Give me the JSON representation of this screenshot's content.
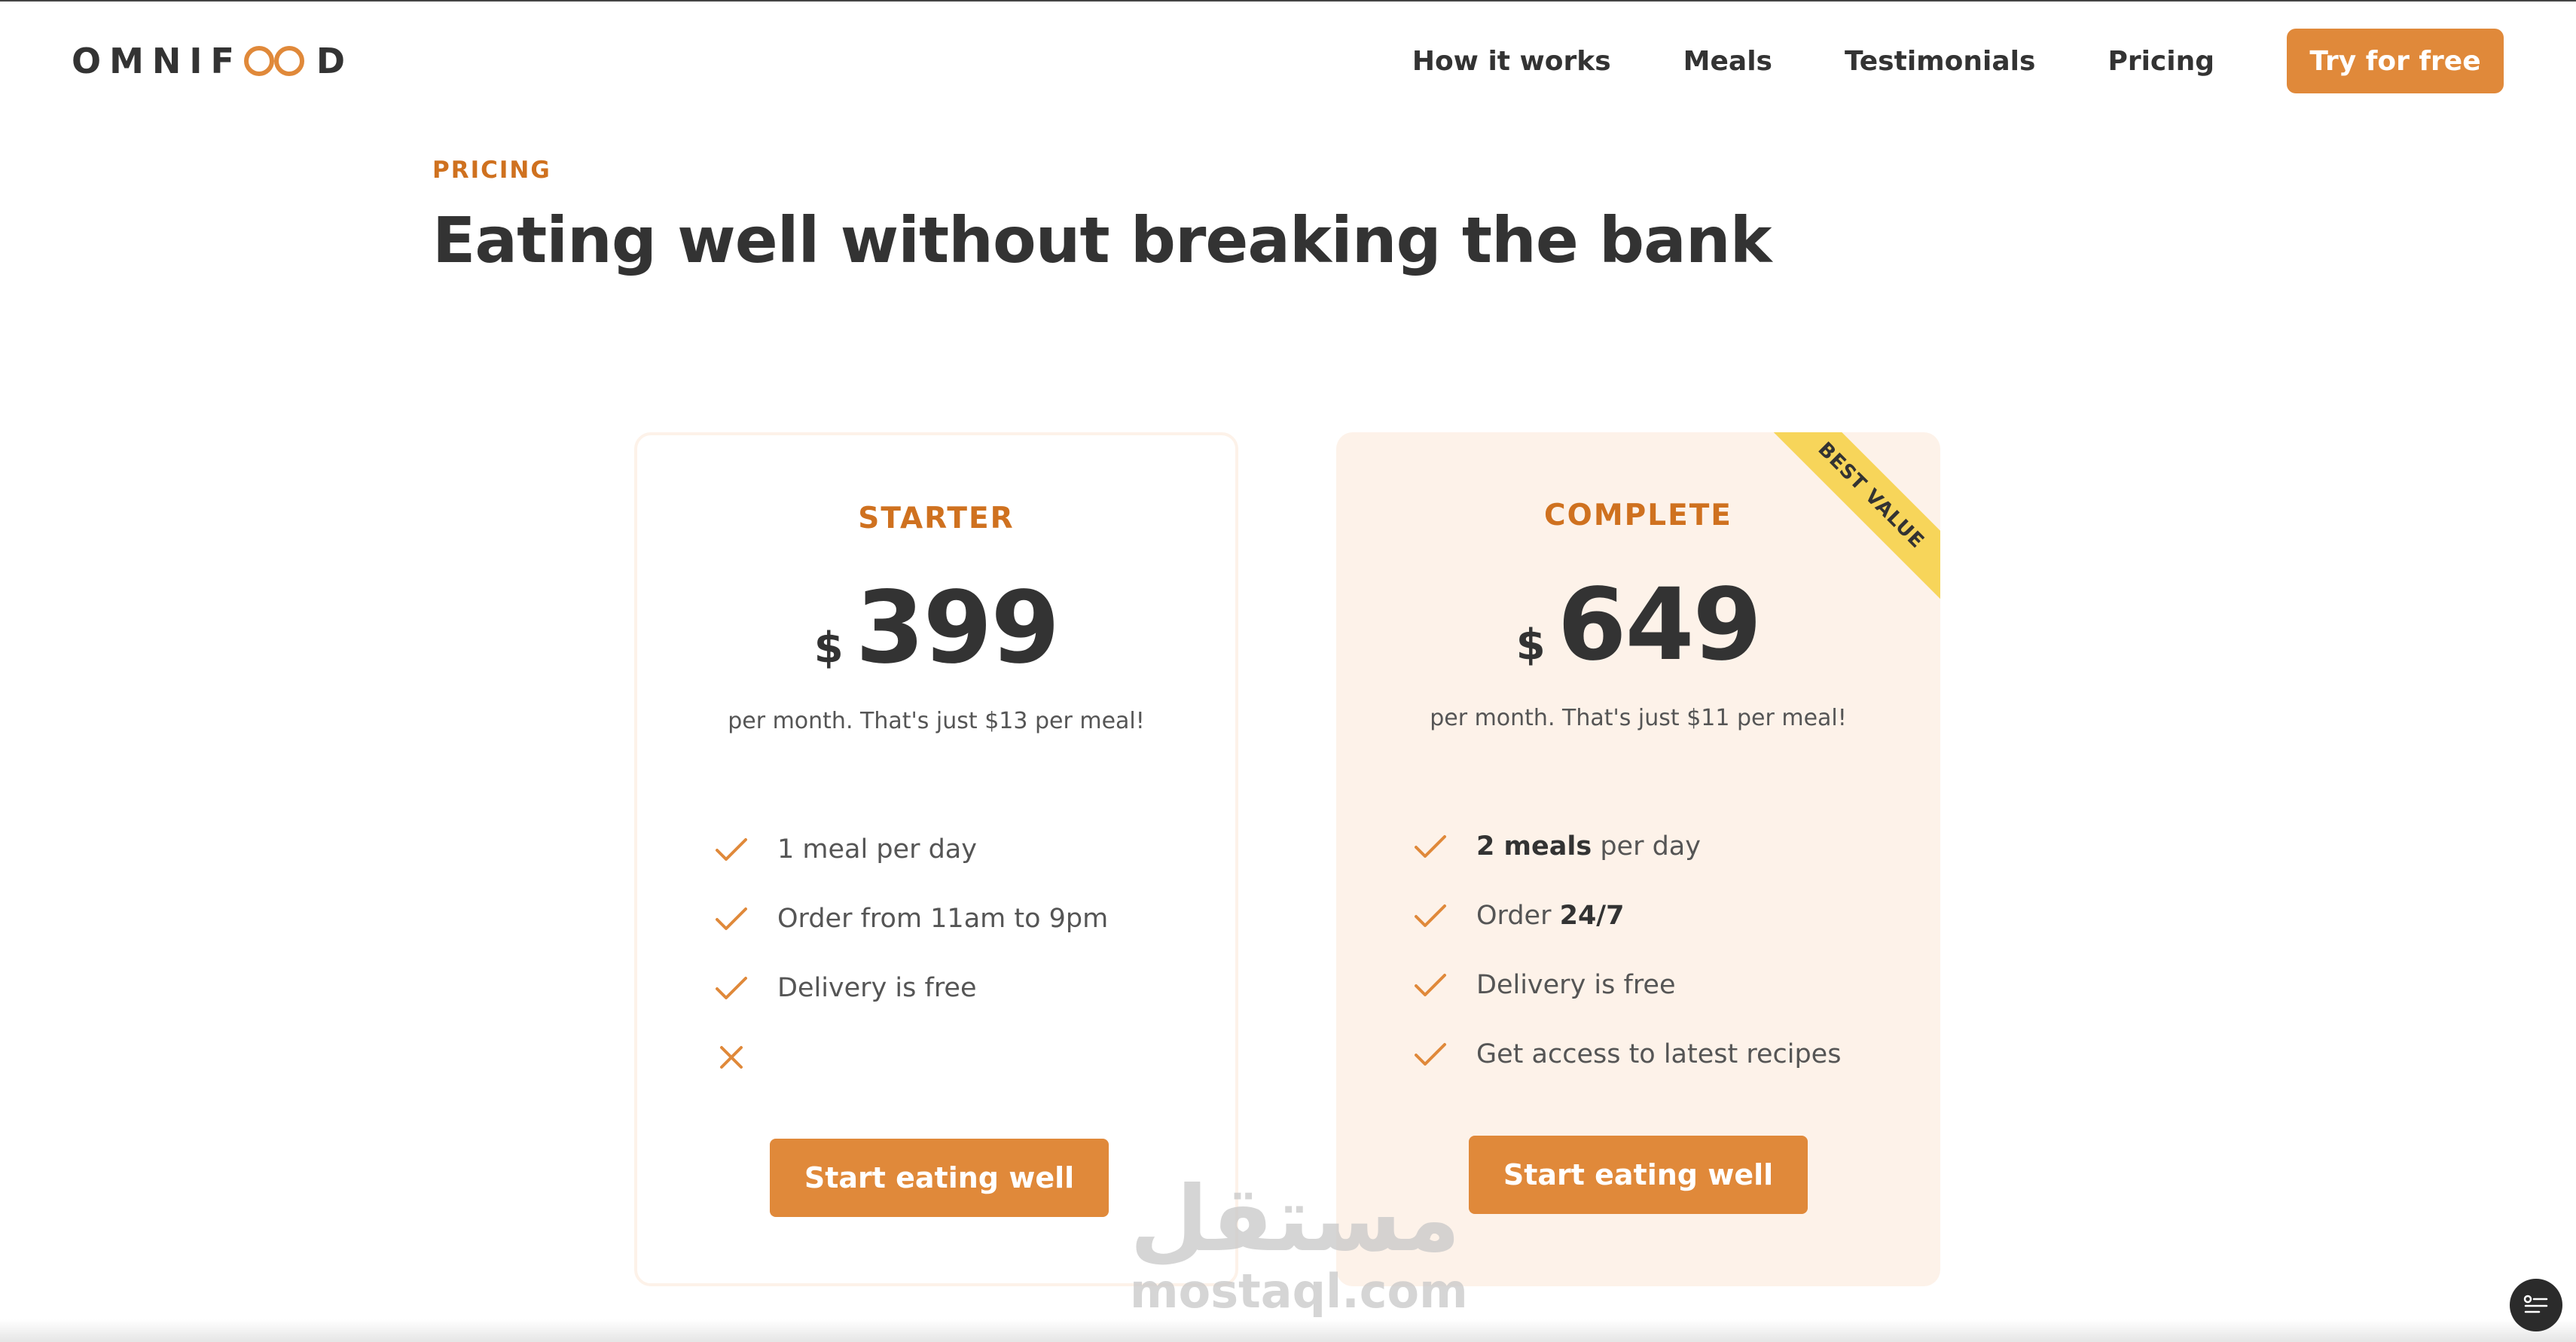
{
  "header": {
    "logo_text_left": "OMNIF",
    "logo_text_right": "D",
    "logo_icon": "infinity-icon",
    "nav": [
      "How it works",
      "Meals",
      "Testimonials",
      "Pricing"
    ],
    "cta_label": "Try for free"
  },
  "section": {
    "eyebrow": "PRICING",
    "title": "Eating well without breaking the bank"
  },
  "plans": [
    {
      "name": "STARTER",
      "currency": "$",
      "price": "399",
      "note": "per month. That's just $13 per meal!",
      "features": [
        {
          "icon": "check-icon",
          "pre": "",
          "bold": "",
          "post": "1 meal per day"
        },
        {
          "icon": "check-icon",
          "pre": "",
          "bold": "",
          "post": "Order from 11am to 9pm"
        },
        {
          "icon": "check-icon",
          "pre": "",
          "bold": "",
          "post": "Delivery is free"
        },
        {
          "icon": "close-icon",
          "pre": "",
          "bold": "",
          "post": ""
        }
      ],
      "button": "Start eating well"
    },
    {
      "name": "COMPLETE",
      "currency": "$",
      "price": "649",
      "note": "per month. That's just $11 per meal!",
      "ribbon": "BEST VALUE",
      "features": [
        {
          "icon": "check-icon",
          "pre": "",
          "bold": "2 meals",
          "post": " per day"
        },
        {
          "icon": "check-icon",
          "pre": "Order ",
          "bold": "24/7",
          "post": ""
        },
        {
          "icon": "check-icon",
          "pre": "",
          "bold": "",
          "post": "Delivery is free"
        },
        {
          "icon": "check-icon",
          "pre": "",
          "bold": "",
          "post": "Get access to latest recipes"
        }
      ],
      "button": "Start eating well"
    }
  ],
  "watermark": {
    "arabic": "مستقل",
    "latin": "mostaql.com"
  },
  "colors": {
    "accent": "#e0893a",
    "accent_dark": "#cf711f",
    "tint": "#fdf2e9",
    "ribbon": "#f7d55a",
    "text": "#333333"
  }
}
